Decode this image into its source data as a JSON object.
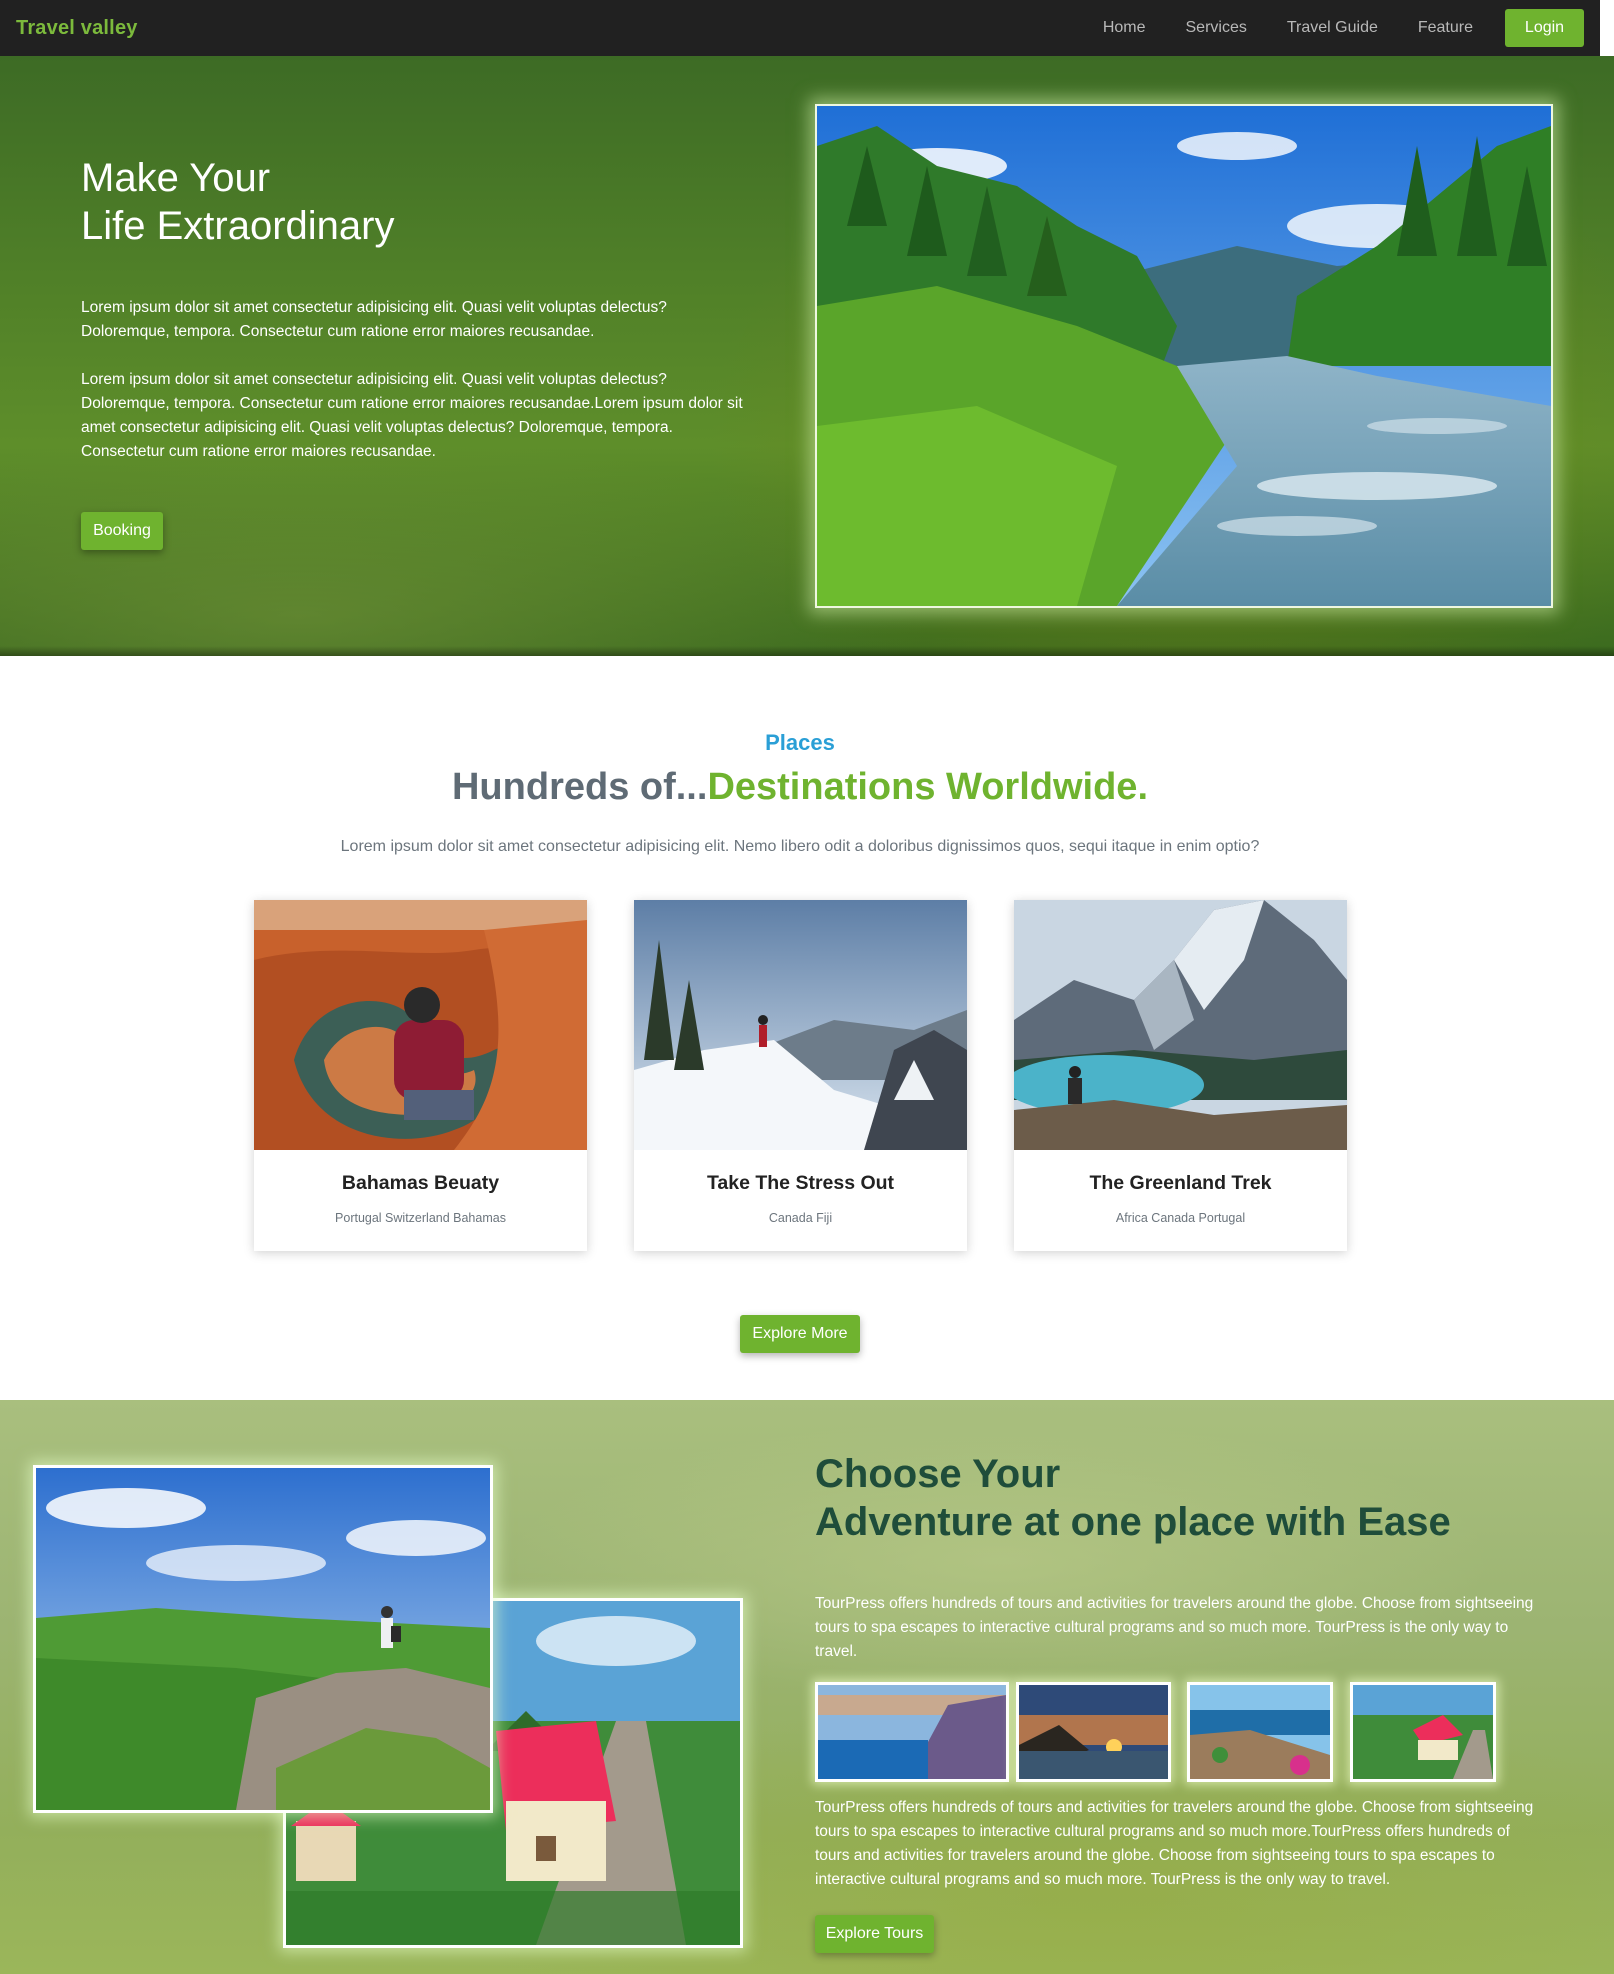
{
  "navbar": {
    "brand": "Travel valley",
    "links": [
      "Home",
      "Services",
      "Travel Guide",
      "Feature"
    ],
    "login_label": "Login"
  },
  "hero": {
    "title_line1": "Make Your",
    "title_line2": "Life Extraordinary",
    "para1": "Lorem ipsum dolor sit amet consectetur adipisicing elit. Quasi velit voluptas delectus? Doloremque, tempora. Consectetur cum ratione error maiores recusandae.",
    "para2": "Lorem ipsum dolor sit amet consectetur adipisicing elit. Quasi velit voluptas delectus? Doloremque, tempora. Consectetur cum ratione error maiores recusandae.Lorem ipsum dolor sit amet consectetur adipisicing elit. Quasi velit voluptas delectus? Doloremque, tempora. Consectetur cum ratione error maiores recusandae.",
    "booking_label": "Booking"
  },
  "places": {
    "subtitle": "Places",
    "title_plain": "Hundreds of...",
    "title_accent": "Destinations Worldwide.",
    "lead": "Lorem ipsum dolor sit amet consectetur adipisicing elit. Nemo libero odit a doloribus dignissimos quos, sequi itaque in enim optio?",
    "cards": [
      {
        "title": "Bahamas Beuaty",
        "locations": "Portugal Switzerland Bahamas"
      },
      {
        "title": "Take The Stress Out",
        "locations": "Canada Fiji"
      },
      {
        "title": "The Greenland Trek",
        "locations": "Africa Canada Portugal"
      }
    ],
    "explore_label": "Explore More"
  },
  "adventure": {
    "title_line1": "Choose Your",
    "title_line2": "Adventure at one place with Ease",
    "para1": "TourPress offers hundreds of tours and activities for travelers around the globe. Choose from sightseeing tours to spa escapes to interactive cultural programs and so much more. TourPress is the only way to travel.",
    "para2": "TourPress offers hundreds of tours and activities for travelers around the globe. Choose from sightseeing tours to spa escapes to interactive cultural programs and so much more.TourPress offers hundreds of tours and activities for travelers around the globe. Choose from sightseeing tours to spa escapes to interactive cultural programs and so much more. TourPress is the only way to travel.",
    "tours_label": "Explore Tours"
  },
  "colors": {
    "accent_green": "#6fb32f",
    "brand_green": "#7cba3c",
    "places_blue": "#2a9fd6",
    "navbar_bg": "#212121",
    "adventure_title": "#1f4d3a"
  }
}
